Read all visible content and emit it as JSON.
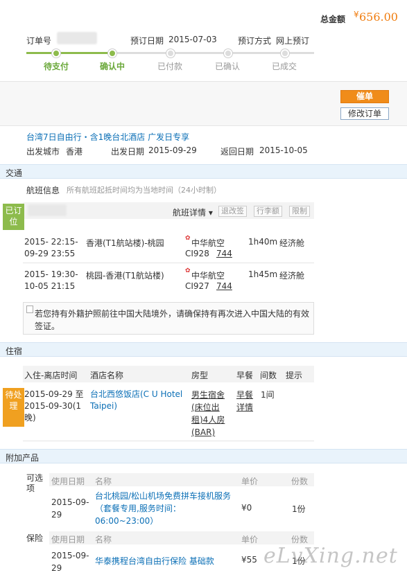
{
  "header": {
    "total_label": "总金额",
    "total_currency": "¥",
    "total_amount": "656.00",
    "order_no_label": "订单号",
    "booking_date_label": "预订日期",
    "booking_date": "2015-07-03",
    "booking_method_label": "预订方式",
    "booking_method": "网上预订"
  },
  "steps": [
    {
      "label": "待支付",
      "state": "done"
    },
    {
      "label": "确认中",
      "state": "current"
    },
    {
      "label": "已付款",
      "state": "todo"
    },
    {
      "label": "已确认",
      "state": "todo"
    },
    {
      "label": "已成交",
      "state": "todo"
    }
  ],
  "actions": {
    "primary": "催单",
    "secondary": "修改订单"
  },
  "product": {
    "title": "台湾7日自由行・含1晚台北酒店 广发日专享",
    "depart_city_label": "出发城市",
    "depart_city": "香港",
    "depart_date_label": "出发日期",
    "depart_date": "2015-09-29",
    "return_date_label": "返回日期",
    "return_date": "2015-10-05"
  },
  "transport": {
    "section": "交通",
    "flight_info_label": "航班信息",
    "flight_info_note": "所有航班起抵时间均为当地时间（24小时制）",
    "status_badge": "已订位",
    "details_label": "航班详情",
    "tags": [
      "退改签",
      "行李额",
      "限制"
    ],
    "flights": [
      {
        "dep": "2015- 22:15-",
        "arr": "09-29 23:55",
        "route": "香港(T1航站楼)-桃园",
        "airline": "中华航空",
        "flight_no": "CI928",
        "plane": "744",
        "duration": "1h40m",
        "cabin": "经济舱"
      },
      {
        "dep": "2015- 19:30-",
        "arr": "10-05 21:15",
        "route": "桃园-香港(T1航站楼)",
        "airline": "中华航空",
        "flight_no": "CI927",
        "plane": "744",
        "duration": "1h45m",
        "cabin": "经济舱"
      }
    ],
    "notice": "若您持有外籍护照前往中国大陆境外，请确保持有再次进入中国大陆的有效签证。"
  },
  "hotel": {
    "section": "住宿",
    "status_badge": "待处理",
    "columns": [
      "入住-离店时间",
      "酒店名称",
      "房型",
      "早餐",
      "间数",
      "提示"
    ],
    "row": {
      "dates": "2015-09-29 至 2015-09-30(1晚)",
      "name": "台北西悠饭店(C U Hotel Taipei)",
      "room": "男生宿舍(床位出租)4人房(BAR)",
      "breakfast": "早餐详情",
      "rooms": "1间"
    }
  },
  "addons": {
    "section": "附加产品",
    "optional_label": "可选项",
    "insurance_label": "保险",
    "columns": [
      "使用日期",
      "名称",
      "单价",
      "份数"
    ],
    "optional_row": {
      "date": "2015-09-29",
      "name": "台北桃园/松山机场免费拼车接机服务（套餐专用,服务时间：06:00~23:00）",
      "price": "¥0",
      "qty": "1份"
    },
    "insurance_row": {
      "date": "2015-09-29",
      "name": "华泰携程台湾自由行保险 基础款",
      "price": "¥55",
      "qty": "1份"
    }
  },
  "watermark": "eLvXing.net"
}
